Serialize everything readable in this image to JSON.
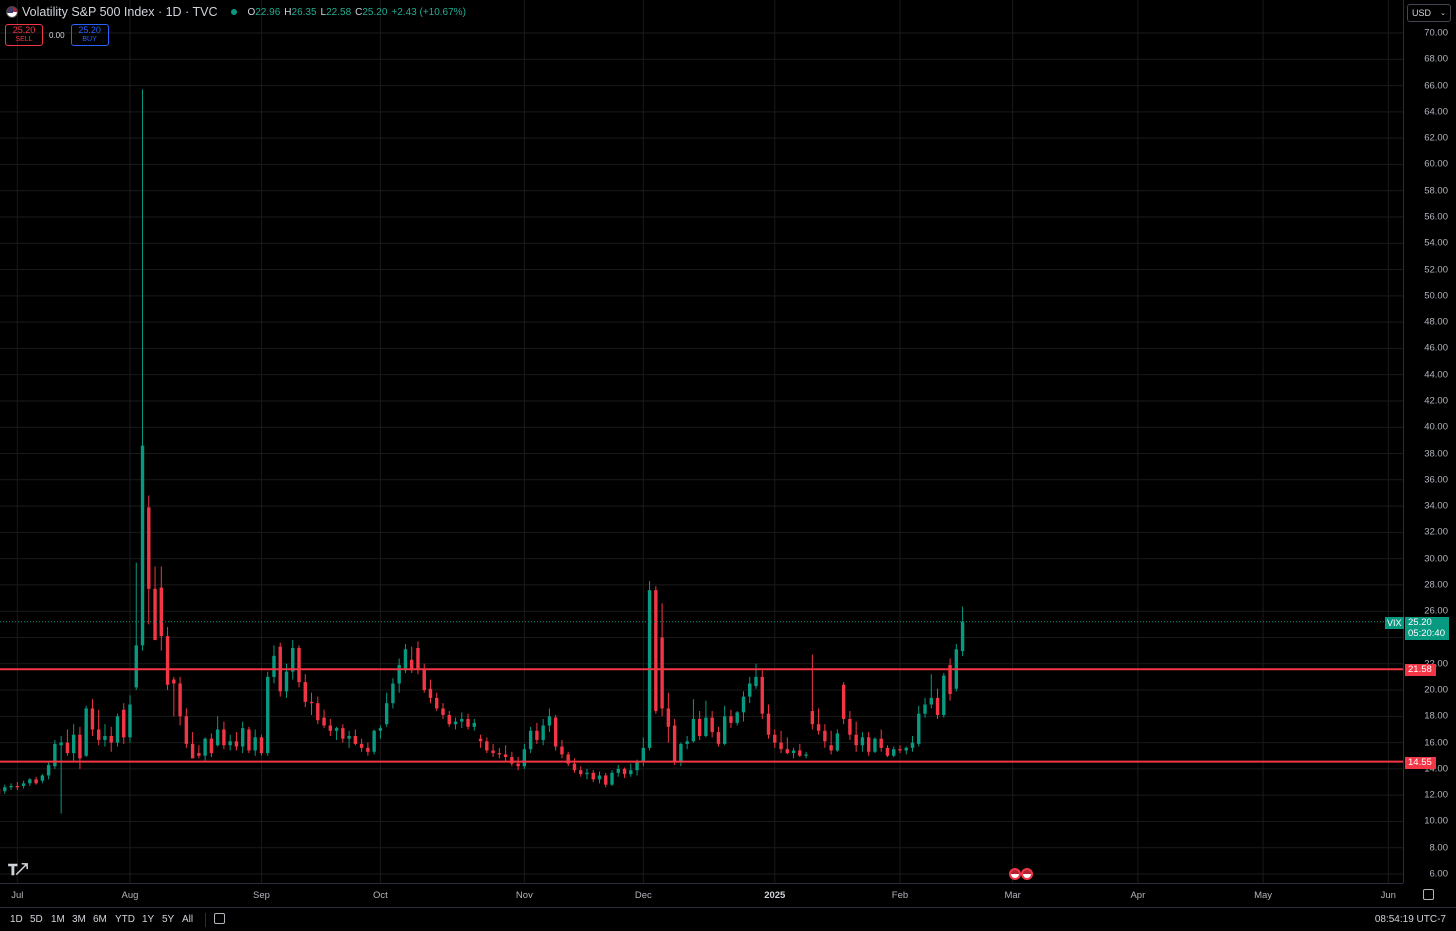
{
  "header": {
    "symbol_title": "Volatility S&P 500 Index · 1D · TVC",
    "ohlc": [
      {
        "key": "O",
        "value": "22.96"
      },
      {
        "key": "H",
        "value": "26.35"
      },
      {
        "key": "L",
        "value": "22.58"
      },
      {
        "key": "C",
        "value": "25.20"
      }
    ],
    "change": "+2.43 (+10.67%)"
  },
  "trade": {
    "sell_price": "25.20",
    "sell_label": "SELL",
    "spread": "0.00",
    "buy_price": "25.20",
    "buy_label": "BUY"
  },
  "currency": {
    "selected": "USD"
  },
  "tags": {
    "symbol": "VIX",
    "last_price": "25.20",
    "countdown": "05:20:40",
    "level_upper": "21.58",
    "level_lower": "14.55"
  },
  "price_axis": {
    "ticks": [
      "70.00",
      "68.00",
      "66.00",
      "64.00",
      "62.00",
      "60.00",
      "58.00",
      "56.00",
      "54.00",
      "52.00",
      "50.00",
      "48.00",
      "46.00",
      "44.00",
      "42.00",
      "40.00",
      "38.00",
      "36.00",
      "34.00",
      "32.00",
      "30.00",
      "28.00",
      "26.00",
      "24.00",
      "22.00",
      "20.00",
      "18.00",
      "16.00",
      "14.00",
      "12.00",
      "10.00",
      "8.00",
      "6.00"
    ]
  },
  "time_axis": {
    "ticks": [
      {
        "label": "Jul",
        "index": -18
      },
      {
        "label": "Aug",
        "index": 0
      },
      {
        "label": "Sep",
        "index": 21
      },
      {
        "label": "Oct",
        "index": 40
      },
      {
        "label": "Nov",
        "index": 63
      },
      {
        "label": "Dec",
        "index": 82
      },
      {
        "label": "2025",
        "index": 103
      },
      {
        "label": "Feb",
        "index": 123
      },
      {
        "label": "Mar",
        "index": 141
      },
      {
        "label": "Apr",
        "index": 161
      },
      {
        "label": "May",
        "index": 181
      },
      {
        "label": "Jun",
        "index": 201
      }
    ],
    "year_label": "2025"
  },
  "bottom_bar": {
    "ranges": [
      "1D",
      "5D",
      "1M",
      "3M",
      "6M",
      "YTD",
      "1Y",
      "5Y",
      "All"
    ],
    "clock": "08:54:19 UTC-7"
  },
  "colors": {
    "up": "#089981",
    "down": "#f23645",
    "level_line": "#f23645",
    "background": "#000000",
    "grid": "#1a1a1a"
  },
  "icons": [
    "flag-icon",
    "status-dot-icon",
    "tradingview-logo-icon",
    "calendar-icon",
    "goto-date-icon",
    "event-flag-icon"
  ],
  "chart_data": {
    "type": "candlestick",
    "title": "Volatility S&P 500 Index · 1D · TVC",
    "ylim": [
      6,
      70
    ],
    "levels": [
      21.58,
      14.55
    ],
    "last_price": 25.2,
    "candles": [
      {
        "o": 12.5,
        "h": 12.7,
        "l": 12.0,
        "c": 12.1
      },
      {
        "o": 12.3,
        "h": 12.8,
        "l": 12.1,
        "c": 12.6
      },
      {
        "o": 12.6,
        "h": 12.9,
        "l": 12.4,
        "c": 12.7
      },
      {
        "o": 12.7,
        "h": 13.0,
        "l": 12.4,
        "c": 12.6
      },
      {
        "o": 12.7,
        "h": 13.1,
        "l": 12.5,
        "c": 12.9
      },
      {
        "o": 12.9,
        "h": 13.3,
        "l": 12.7,
        "c": 13.2
      },
      {
        "o": 13.2,
        "h": 13.4,
        "l": 12.8,
        "c": 12.9
      },
      {
        "o": 13.1,
        "h": 13.6,
        "l": 12.9,
        "c": 13.5
      },
      {
        "o": 13.5,
        "h": 14.5,
        "l": 13.2,
        "c": 14.3
      },
      {
        "o": 14.2,
        "h": 16.2,
        "l": 14.0,
        "c": 15.9
      },
      {
        "o": 15.8,
        "h": 16.5,
        "l": 10.6,
        "c": 16.0
      },
      {
        "o": 16.0,
        "h": 17.0,
        "l": 15.0,
        "c": 15.2
      },
      {
        "o": 15.2,
        "h": 17.4,
        "l": 14.6,
        "c": 16.6
      },
      {
        "o": 16.6,
        "h": 17.2,
        "l": 14.0,
        "c": 14.8
      },
      {
        "o": 15.0,
        "h": 18.8,
        "l": 14.9,
        "c": 18.6
      },
      {
        "o": 18.6,
        "h": 19.3,
        "l": 16.5,
        "c": 17.0
      },
      {
        "o": 17.0,
        "h": 18.5,
        "l": 15.8,
        "c": 16.2
      },
      {
        "o": 16.2,
        "h": 17.4,
        "l": 15.7,
        "c": 16.5
      },
      {
        "o": 16.5,
        "h": 17.2,
        "l": 15.3,
        "c": 16.0
      },
      {
        "o": 16.0,
        "h": 18.2,
        "l": 15.7,
        "c": 18.0
      },
      {
        "o": 18.5,
        "h": 19.0,
        "l": 15.9,
        "c": 16.4
      },
      {
        "o": 16.4,
        "h": 19.6,
        "l": 16.0,
        "c": 18.9
      },
      {
        "o": 20.2,
        "h": 29.7,
        "l": 20.0,
        "c": 23.4
      },
      {
        "o": 23.4,
        "h": 65.7,
        "l": 23.0,
        "c": 38.6
      },
      {
        "o": 33.9,
        "h": 34.8,
        "l": 25.0,
        "c": 27.7
      },
      {
        "o": 27.7,
        "h": 29.4,
        "l": 24.0,
        "c": 23.8
      },
      {
        "o": 27.8,
        "h": 29.4,
        "l": 23.0,
        "c": 24.1
      },
      {
        "o": 24.1,
        "h": 24.8,
        "l": 20.0,
        "c": 20.4
      },
      {
        "o": 20.8,
        "h": 21.0,
        "l": 18.0,
        "c": 20.5
      },
      {
        "o": 20.5,
        "h": 21.0,
        "l": 17.3,
        "c": 18.0
      },
      {
        "o": 18.0,
        "h": 18.6,
        "l": 15.6,
        "c": 15.9
      },
      {
        "o": 15.9,
        "h": 16.8,
        "l": 14.8,
        "c": 14.8
      },
      {
        "o": 15.2,
        "h": 15.8,
        "l": 14.8,
        "c": 15.0
      },
      {
        "o": 15.0,
        "h": 16.4,
        "l": 14.6,
        "c": 16.3
      },
      {
        "o": 16.3,
        "h": 16.7,
        "l": 14.9,
        "c": 15.2
      },
      {
        "o": 15.8,
        "h": 18.0,
        "l": 15.7,
        "c": 17.0
      },
      {
        "o": 17.0,
        "h": 17.6,
        "l": 15.5,
        "c": 15.8
      },
      {
        "o": 15.8,
        "h": 16.6,
        "l": 15.4,
        "c": 16.1
      },
      {
        "o": 16.1,
        "h": 16.8,
        "l": 15.4,
        "c": 15.7
      },
      {
        "o": 15.7,
        "h": 17.6,
        "l": 15.2,
        "c": 17.1
      },
      {
        "o": 17.0,
        "h": 17.2,
        "l": 15.2,
        "c": 15.4
      },
      {
        "o": 15.4,
        "h": 17.0,
        "l": 15.0,
        "c": 16.4
      },
      {
        "o": 16.4,
        "h": 16.6,
        "l": 15.0,
        "c": 15.2
      },
      {
        "o": 15.2,
        "h": 21.4,
        "l": 15.0,
        "c": 21.0
      },
      {
        "o": 21.0,
        "h": 23.4,
        "l": 20.5,
        "c": 22.6
      },
      {
        "o": 23.3,
        "h": 23.6,
        "l": 19.5,
        "c": 19.9
      },
      {
        "o": 19.9,
        "h": 22.0,
        "l": 19.4,
        "c": 21.4
      },
      {
        "o": 21.4,
        "h": 23.8,
        "l": 20.8,
        "c": 23.2
      },
      {
        "o": 23.2,
        "h": 23.4,
        "l": 20.2,
        "c": 20.6
      },
      {
        "o": 20.6,
        "h": 21.2,
        "l": 18.7,
        "c": 19.1
      },
      {
        "o": 19.1,
        "h": 19.8,
        "l": 18.1,
        "c": 19.0
      },
      {
        "o": 19.0,
        "h": 19.5,
        "l": 17.4,
        "c": 17.7
      },
      {
        "o": 17.9,
        "h": 18.5,
        "l": 17.1,
        "c": 17.3
      },
      {
        "o": 17.3,
        "h": 17.8,
        "l": 16.5,
        "c": 16.9
      },
      {
        "o": 16.9,
        "h": 17.2,
        "l": 16.2,
        "c": 17.1
      },
      {
        "o": 17.1,
        "h": 17.4,
        "l": 16.0,
        "c": 16.3
      },
      {
        "o": 16.3,
        "h": 16.9,
        "l": 15.6,
        "c": 16.5
      },
      {
        "o": 16.5,
        "h": 17.0,
        "l": 15.8,
        "c": 15.9
      },
      {
        "o": 15.9,
        "h": 16.3,
        "l": 15.3,
        "c": 15.6
      },
      {
        "o": 15.6,
        "h": 16.0,
        "l": 15.0,
        "c": 15.3
      },
      {
        "o": 15.3,
        "h": 17.0,
        "l": 15.1,
        "c": 16.9
      },
      {
        "o": 16.9,
        "h": 17.3,
        "l": 16.3,
        "c": 17.1
      },
      {
        "o": 17.4,
        "h": 19.8,
        "l": 17.2,
        "c": 19.0
      },
      {
        "o": 19.0,
        "h": 20.9,
        "l": 18.6,
        "c": 20.5
      },
      {
        "o": 20.5,
        "h": 22.4,
        "l": 19.8,
        "c": 21.9
      },
      {
        "o": 21.5,
        "h": 23.5,
        "l": 21.3,
        "c": 23.1
      },
      {
        "o": 22.3,
        "h": 23.3,
        "l": 21.3,
        "c": 21.5
      },
      {
        "o": 23.2,
        "h": 23.7,
        "l": 21.2,
        "c": 21.6
      },
      {
        "o": 21.6,
        "h": 22.0,
        "l": 19.8,
        "c": 20.0
      },
      {
        "o": 20.1,
        "h": 20.8,
        "l": 19.0,
        "c": 19.4
      },
      {
        "o": 19.4,
        "h": 19.8,
        "l": 18.4,
        "c": 18.6
      },
      {
        "o": 18.6,
        "h": 19.0,
        "l": 17.8,
        "c": 18.1
      },
      {
        "o": 18.1,
        "h": 18.4,
        "l": 17.2,
        "c": 17.4
      },
      {
        "o": 17.4,
        "h": 17.9,
        "l": 17.0,
        "c": 17.6
      },
      {
        "o": 17.6,
        "h": 18.3,
        "l": 17.1,
        "c": 17.8
      },
      {
        "o": 17.8,
        "h": 18.2,
        "l": 17.0,
        "c": 17.2
      },
      {
        "o": 17.2,
        "h": 17.8,
        "l": 16.9,
        "c": 17.5
      },
      {
        "o": 16.3,
        "h": 16.6,
        "l": 15.6,
        "c": 16.1
      },
      {
        "o": 16.1,
        "h": 16.4,
        "l": 15.2,
        "c": 15.4
      },
      {
        "o": 15.4,
        "h": 15.9,
        "l": 14.9,
        "c": 15.2
      },
      {
        "o": 15.2,
        "h": 15.6,
        "l": 14.8,
        "c": 15.1
      },
      {
        "o": 15.1,
        "h": 15.8,
        "l": 14.6,
        "c": 14.9
      },
      {
        "o": 14.9,
        "h": 15.3,
        "l": 14.2,
        "c": 14.4
      },
      {
        "o": 14.4,
        "h": 14.9,
        "l": 13.9,
        "c": 14.2
      },
      {
        "o": 14.2,
        "h": 15.9,
        "l": 14.0,
        "c": 15.5
      },
      {
        "o": 15.5,
        "h": 17.2,
        "l": 15.2,
        "c": 16.9
      },
      {
        "o": 16.9,
        "h": 17.5,
        "l": 15.9,
        "c": 16.2
      },
      {
        "o": 16.2,
        "h": 17.8,
        "l": 15.8,
        "c": 17.3
      },
      {
        "o": 17.3,
        "h": 18.6,
        "l": 16.8,
        "c": 18.0
      },
      {
        "o": 17.9,
        "h": 18.1,
        "l": 15.4,
        "c": 15.7
      },
      {
        "o": 15.7,
        "h": 16.2,
        "l": 14.8,
        "c": 15.1
      },
      {
        "o": 15.1,
        "h": 15.3,
        "l": 14.2,
        "c": 14.4
      },
      {
        "o": 14.4,
        "h": 14.8,
        "l": 13.7,
        "c": 13.9
      },
      {
        "o": 13.9,
        "h": 14.2,
        "l": 13.4,
        "c": 13.6
      },
      {
        "o": 13.6,
        "h": 14.0,
        "l": 13.2,
        "c": 13.7
      },
      {
        "o": 13.7,
        "h": 13.9,
        "l": 13.0,
        "c": 13.2
      },
      {
        "o": 13.2,
        "h": 13.8,
        "l": 12.9,
        "c": 13.5
      },
      {
        "o": 13.5,
        "h": 13.7,
        "l": 12.6,
        "c": 12.8
      },
      {
        "o": 12.8,
        "h": 13.9,
        "l": 12.7,
        "c": 13.7
      },
      {
        "o": 13.7,
        "h": 14.3,
        "l": 13.4,
        "c": 14.0
      },
      {
        "o": 14.0,
        "h": 14.1,
        "l": 13.3,
        "c": 13.6
      },
      {
        "o": 13.6,
        "h": 14.4,
        "l": 13.4,
        "c": 13.9
      },
      {
        "o": 13.9,
        "h": 14.7,
        "l": 13.5,
        "c": 14.5
      },
      {
        "o": 14.5,
        "h": 16.4,
        "l": 14.2,
        "c": 15.6
      },
      {
        "o": 15.6,
        "h": 28.3,
        "l": 15.4,
        "c": 27.6
      },
      {
        "o": 27.6,
        "h": 27.9,
        "l": 18.2,
        "c": 18.4
      },
      {
        "o": 24.0,
        "h": 26.6,
        "l": 18.0,
        "c": 18.6
      },
      {
        "o": 18.6,
        "h": 19.8,
        "l": 16.0,
        "c": 17.2
      },
      {
        "o": 17.3,
        "h": 17.8,
        "l": 14.3,
        "c": 14.6
      },
      {
        "o": 14.6,
        "h": 16.0,
        "l": 14.2,
        "c": 15.9
      },
      {
        "o": 15.9,
        "h": 16.5,
        "l": 15.5,
        "c": 16.1
      },
      {
        "o": 16.1,
        "h": 19.3,
        "l": 16.0,
        "c": 17.8
      },
      {
        "o": 17.8,
        "h": 18.4,
        "l": 16.2,
        "c": 16.5
      },
      {
        "o": 16.5,
        "h": 19.2,
        "l": 16.4,
        "c": 17.9
      },
      {
        "o": 17.9,
        "h": 18.4,
        "l": 16.4,
        "c": 16.8
      },
      {
        "o": 16.8,
        "h": 17.2,
        "l": 15.7,
        "c": 15.9
      },
      {
        "o": 15.9,
        "h": 18.8,
        "l": 15.8,
        "c": 18.0
      },
      {
        "o": 18.0,
        "h": 18.5,
        "l": 17.1,
        "c": 17.5
      },
      {
        "o": 17.5,
        "h": 18.4,
        "l": 17.3,
        "c": 18.3
      },
      {
        "o": 18.3,
        "h": 19.9,
        "l": 17.6,
        "c": 19.5
      },
      {
        "o": 19.5,
        "h": 21.0,
        "l": 19.0,
        "c": 20.5
      },
      {
        "o": 20.3,
        "h": 22.0,
        "l": 20.1,
        "c": 21.0
      },
      {
        "o": 21.0,
        "h": 21.5,
        "l": 17.8,
        "c": 18.2
      },
      {
        "o": 18.2,
        "h": 18.9,
        "l": 16.3,
        "c": 16.6
      },
      {
        "o": 16.6,
        "h": 17.0,
        "l": 15.6,
        "c": 16.0
      },
      {
        "o": 16.0,
        "h": 16.9,
        "l": 15.2,
        "c": 15.5
      },
      {
        "o": 15.5,
        "h": 16.4,
        "l": 15.1,
        "c": 15.2
      },
      {
        "o": 15.2,
        "h": 15.6,
        "l": 14.8,
        "c": 15.4
      },
      {
        "o": 15.4,
        "h": 15.9,
        "l": 14.9,
        "c": 15.0
      },
      {
        "o": 15.0,
        "h": 15.3,
        "l": 14.8,
        "c": 15.1
      },
      {
        "o": 18.4,
        "h": 22.7,
        "l": 17.0,
        "c": 17.4
      },
      {
        "o": 17.4,
        "h": 18.6,
        "l": 16.6,
        "c": 16.9
      },
      {
        "o": 16.9,
        "h": 17.4,
        "l": 15.6,
        "c": 16.1
      },
      {
        "o": 15.8,
        "h": 16.9,
        "l": 15.1,
        "c": 15.4
      },
      {
        "o": 15.4,
        "h": 17.0,
        "l": 15.3,
        "c": 16.7
      },
      {
        "o": 20.4,
        "h": 20.6,
        "l": 17.4,
        "c": 17.8
      },
      {
        "o": 17.8,
        "h": 18.4,
        "l": 16.2,
        "c": 16.6
      },
      {
        "o": 16.6,
        "h": 17.6,
        "l": 15.3,
        "c": 15.8
      },
      {
        "o": 15.8,
        "h": 16.8,
        "l": 15.3,
        "c": 16.4
      },
      {
        "o": 16.4,
        "h": 16.8,
        "l": 15.0,
        "c": 15.3
      },
      {
        "o": 15.3,
        "h": 16.4,
        "l": 15.2,
        "c": 16.3
      },
      {
        "o": 16.3,
        "h": 17.0,
        "l": 15.3,
        "c": 15.6
      },
      {
        "o": 15.6,
        "h": 15.8,
        "l": 14.9,
        "c": 15.0
      },
      {
        "o": 15.0,
        "h": 15.7,
        "l": 14.9,
        "c": 15.5
      },
      {
        "o": 15.5,
        "h": 15.8,
        "l": 15.2,
        "c": 15.4
      },
      {
        "o": 15.4,
        "h": 15.7,
        "l": 15.1,
        "c": 15.6
      },
      {
        "o": 15.6,
        "h": 16.5,
        "l": 15.3,
        "c": 16.0
      },
      {
        "o": 15.9,
        "h": 18.8,
        "l": 15.7,
        "c": 18.2
      },
      {
        "o": 18.2,
        "h": 19.4,
        "l": 17.9,
        "c": 18.9
      },
      {
        "o": 18.9,
        "h": 21.2,
        "l": 18.6,
        "c": 19.4
      },
      {
        "o": 19.4,
        "h": 20.1,
        "l": 17.8,
        "c": 18.1
      },
      {
        "o": 18.1,
        "h": 21.3,
        "l": 17.9,
        "c": 21.1
      },
      {
        "o": 21.9,
        "h": 22.4,
        "l": 19.2,
        "c": 19.7
      },
      {
        "o": 20.1,
        "h": 23.5,
        "l": 19.9,
        "c": 23.1
      },
      {
        "o": 22.96,
        "h": 26.35,
        "l": 22.58,
        "c": 25.2
      }
    ]
  }
}
